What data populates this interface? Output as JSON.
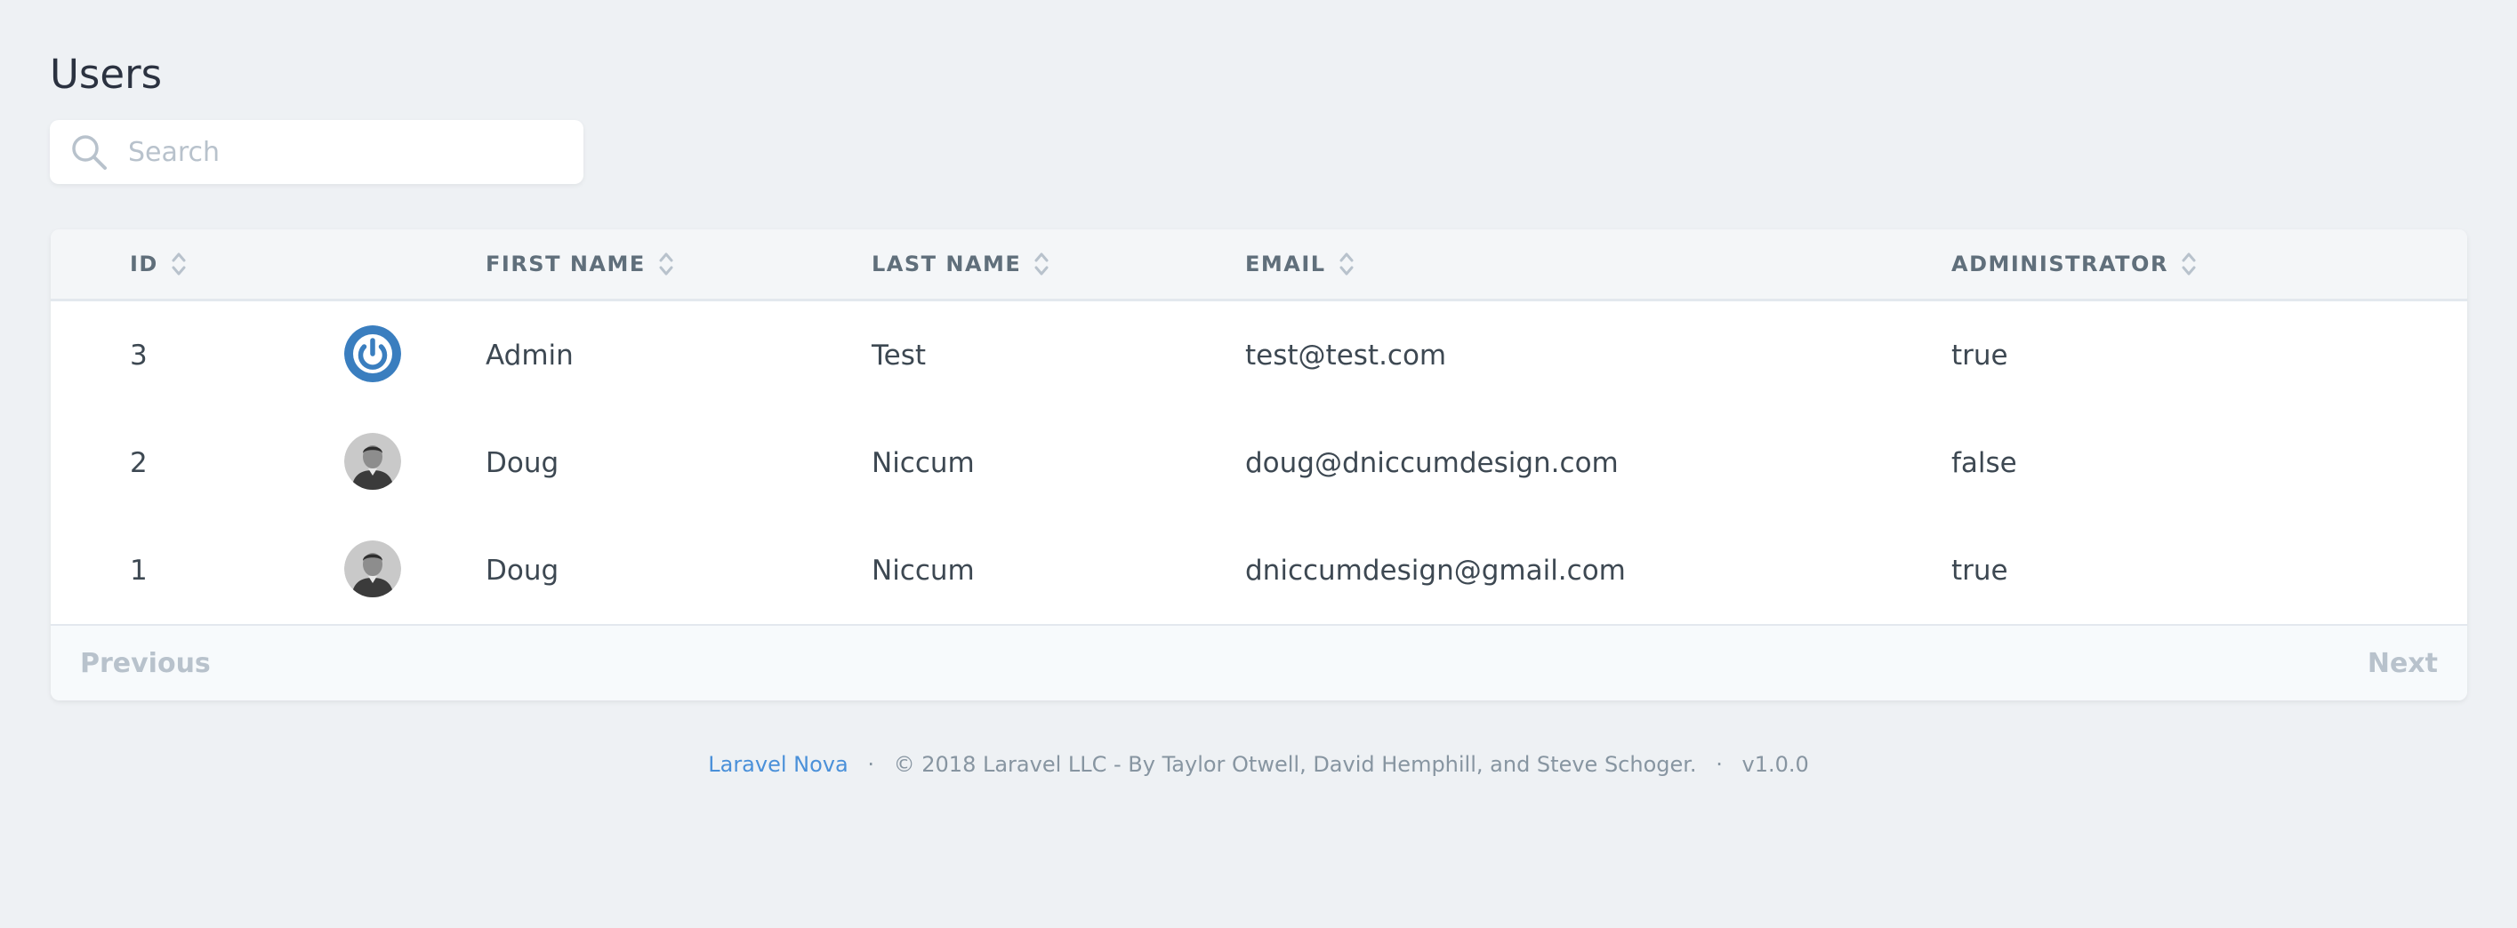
{
  "page": {
    "title": "Users"
  },
  "search": {
    "placeholder": "Search",
    "value": ""
  },
  "table": {
    "columns": [
      {
        "label": "ID"
      },
      {
        "label": "FIRST NAME"
      },
      {
        "label": "LAST NAME"
      },
      {
        "label": "EMAIL"
      },
      {
        "label": "ADMINISTRATOR"
      }
    ],
    "rows": [
      {
        "id": "3",
        "avatar_icon": "power-logo-icon",
        "first_name": "Admin",
        "last_name": "Test",
        "email": "test@test.com",
        "administrator": "true"
      },
      {
        "id": "2",
        "avatar_icon": "user-photo-icon",
        "first_name": "Doug",
        "last_name": "Niccum",
        "email": "doug@dniccumdesign.com",
        "administrator": "false"
      },
      {
        "id": "1",
        "avatar_icon": "user-photo-icon",
        "first_name": "Doug",
        "last_name": "Niccum",
        "email": "dniccumdesign@gmail.com",
        "administrator": "true"
      }
    ]
  },
  "pagination": {
    "previous_label": "Previous",
    "next_label": "Next"
  },
  "footer": {
    "brand_link": "Laravel Nova",
    "separator": "·",
    "copyright": "© 2018 Laravel LLC - By Taylor Otwell, David Hemphill, and Steve Schoger.",
    "version": "v1.0.0"
  },
  "colors": {
    "background": "#eef1f4",
    "link": "#4a90d9",
    "header_text": "#606f7b",
    "muted": "#b8c2cc",
    "avatar_accent": "#3a7ebf"
  }
}
